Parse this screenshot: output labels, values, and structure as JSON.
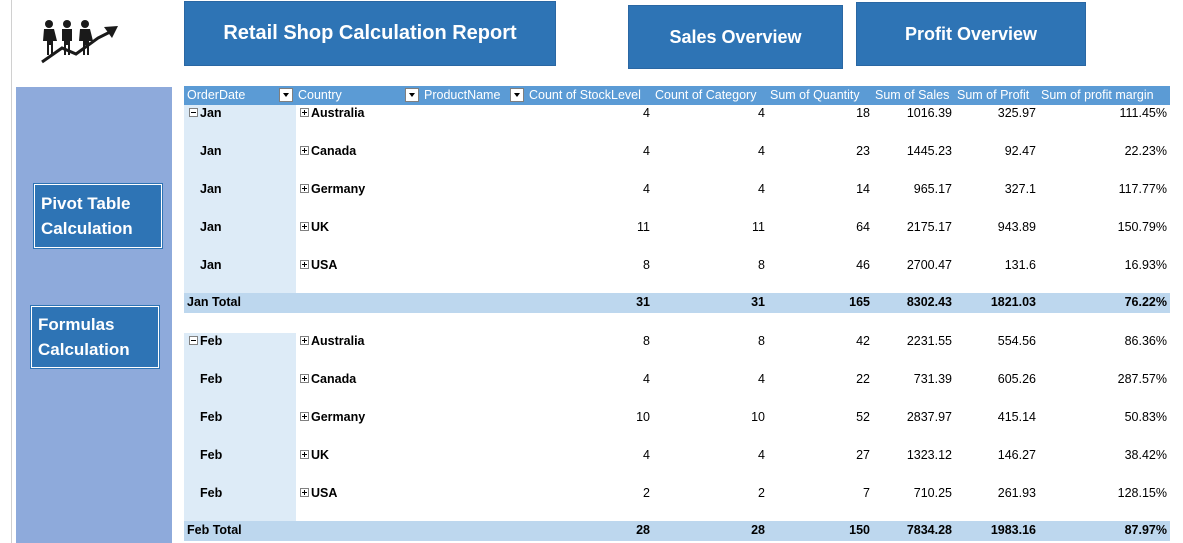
{
  "header": {
    "title": "Retail Shop Calculation  Report",
    "sales_button": "Sales Overview",
    "profit_button": "Profit Overview",
    "logo_icon": "people-growth-icon"
  },
  "sidebar": {
    "pivot_button": [
      "Pivot Table",
      "Calculation"
    ],
    "formulas_button": [
      "Formulas",
      "Calculation"
    ]
  },
  "pivot": {
    "columns": [
      "OrderDate",
      "Country",
      "ProductName",
      "Count of StockLevel",
      "Count of Category",
      "Sum of Quantity",
      "Sum of Sales",
      "Sum of Profit",
      "Sum of profit margin"
    ],
    "groups": [
      {
        "month": "Jan",
        "rows": [
          {
            "date": "Jan",
            "country": "Australia",
            "stock": "4",
            "category": "4",
            "qty": "18",
            "sales": "1016.39",
            "profit": "325.97",
            "margin": "111.45%"
          },
          {
            "date": "Jan",
            "country": "Canada",
            "stock": "4",
            "category": "4",
            "qty": "23",
            "sales": "1445.23",
            "profit": "92.47",
            "margin": "22.23%"
          },
          {
            "date": "Jan",
            "country": "Germany",
            "stock": "4",
            "category": "4",
            "qty": "14",
            "sales": "965.17",
            "profit": "327.1",
            "margin": "117.77%"
          },
          {
            "date": "Jan",
            "country": "UK",
            "stock": "11",
            "category": "11",
            "qty": "64",
            "sales": "2175.17",
            "profit": "943.89",
            "margin": "150.79%"
          },
          {
            "date": "Jan",
            "country": "USA",
            "stock": "8",
            "category": "8",
            "qty": "46",
            "sales": "2700.47",
            "profit": "131.6",
            "margin": "16.93%"
          }
        ],
        "total": {
          "label": "Jan Total",
          "stock": "31",
          "category": "31",
          "qty": "165",
          "sales": "8302.43",
          "profit": "1821.03",
          "margin": "76.22%"
        }
      },
      {
        "month": "Feb",
        "rows": [
          {
            "date": "Feb",
            "country": "Australia",
            "stock": "8",
            "category": "8",
            "qty": "42",
            "sales": "2231.55",
            "profit": "554.56",
            "margin": "86.36%"
          },
          {
            "date": "Feb",
            "country": "Canada",
            "stock": "4",
            "category": "4",
            "qty": "22",
            "sales": "731.39",
            "profit": "605.26",
            "margin": "287.57%"
          },
          {
            "date": "Feb",
            "country": "Germany",
            "stock": "10",
            "category": "10",
            "qty": "52",
            "sales": "2837.97",
            "profit": "415.14",
            "margin": "50.83%"
          },
          {
            "date": "Feb",
            "country": "UK",
            "stock": "4",
            "category": "4",
            "qty": "27",
            "sales": "1323.12",
            "profit": "146.27",
            "margin": "38.42%"
          },
          {
            "date": "Feb",
            "country": "USA",
            "stock": "2",
            "category": "2",
            "qty": "7",
            "sales": "710.25",
            "profit": "261.93",
            "margin": "128.15%"
          }
        ],
        "total": {
          "label": "Feb Total",
          "stock": "28",
          "category": "28",
          "qty": "150",
          "sales": "7834.28",
          "profit": "1983.16",
          "margin": "87.97%"
        }
      }
    ]
  },
  "colors": {
    "button_blue": "#2e74b5",
    "sidebar_blue": "#8eaadb",
    "header_blue": "#5b9bd5",
    "row_shade": "#ddebf7",
    "total_shade": "#bdd7ee"
  }
}
